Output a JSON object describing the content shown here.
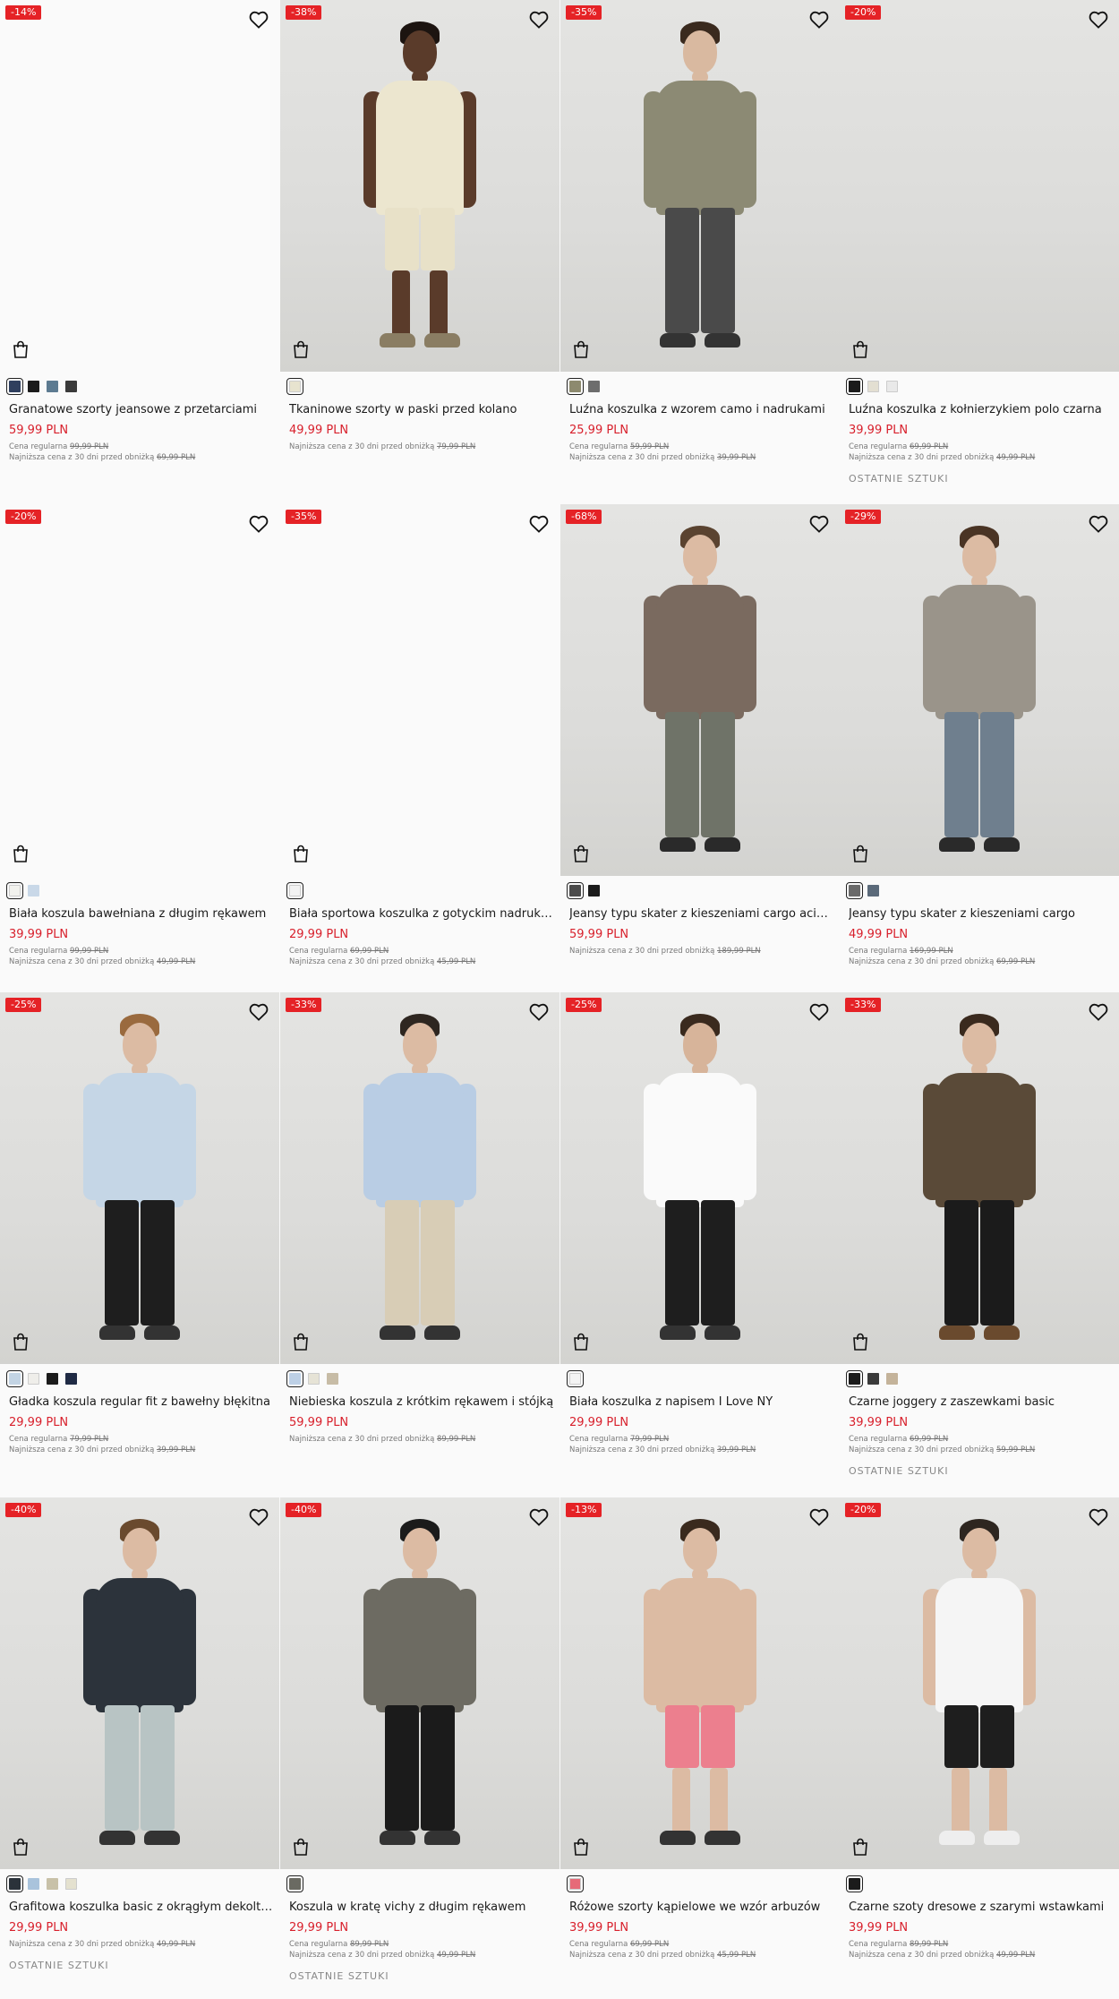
{
  "labels": {
    "regular_prefix": "Cena regularna",
    "lowest_prefix": "Najniższa cena z 30 dni przed obniżką",
    "last_pieces": "OSTATNIE SZTUKI"
  },
  "products": [
    {
      "badge": "-14%",
      "name": "Granatowe szorty jeansowe z przetarciami",
      "price": "59,99 PLN",
      "regular": "99,99 PLN",
      "lowest": "69,99 PLN",
      "last": false,
      "swatches": [
        "#2f3f5e",
        "#1b1b1b",
        "#5d7b91",
        "#3a3a3a"
      ]
    },
    {
      "badge": "-38%",
      "name": "Tkaninowe szorty w paski przed kolano",
      "price": "49,99 PLN",
      "regular": "",
      "lowest": "79,99 PLN",
      "last": false,
      "swatches": [
        "#e7e3cf"
      ]
    },
    {
      "badge": "-35%",
      "name": "Luźna koszulka z wzorem camo i nadrukami",
      "price": "25,99 PLN",
      "regular": "59,99 PLN",
      "lowest": "39,99 PLN",
      "last": false,
      "swatches": [
        "#8d8a6e",
        "#6d6d6d"
      ]
    },
    {
      "badge": "-20%",
      "name": "Luźna koszulka z kołnierzykiem polo czarna",
      "price": "39,99 PLN",
      "regular": "69,99 PLN",
      "lowest": "49,99 PLN",
      "last": true,
      "swatches": [
        "#1b1b1b",
        "#e3dfd2",
        "#e9e9e9"
      ]
    },
    {
      "badge": "-20%",
      "name": "Biała koszula bawełniana z długim rękawem",
      "price": "39,99 PLN",
      "regular": "99,99 PLN",
      "lowest": "49,99 PLN",
      "last": false,
      "swatches": [
        "#f2f2ee",
        "#c9d8e8"
      ]
    },
    {
      "badge": "-35%",
      "name": "Biała sportowa koszulka z gotyckim nadrukiem",
      "price": "29,99 PLN",
      "regular": "69,99 PLN",
      "lowest": "45,99 PLN",
      "last": false,
      "swatches": [
        "#f2f2f2"
      ]
    },
    {
      "badge": "-68%",
      "name": "Jeansy typu skater z kieszeniami cargo acid wash",
      "price": "59,99 PLN",
      "regular": "",
      "lowest": "189,99 PLN",
      "last": false,
      "swatches": [
        "#4b4b4b",
        "#1b1b1b"
      ]
    },
    {
      "badge": "-29%",
      "name": "Jeansy typu skater z kieszeniami cargo",
      "price": "49,99 PLN",
      "regular": "169,99 PLN",
      "lowest": "69,99 PLN",
      "last": false,
      "swatches": [
        "#6a6a6a",
        "#5b6a7a"
      ]
    },
    {
      "badge": "-25%",
      "name": "Gładka koszula regular fit z bawełny błękitna",
      "price": "29,99 PLN",
      "regular": "79,99 PLN",
      "lowest": "39,99 PLN",
      "last": false,
      "swatches": [
        "#c3d4e4",
        "#efeeea",
        "#1b1b1b",
        "#1f2a44"
      ]
    },
    {
      "badge": "-33%",
      "name": "Niebieska koszula z krótkim rękawem i stójką",
      "price": "59,99 PLN",
      "regular": "",
      "lowest": "89,99 PLN",
      "last": false,
      "swatches": [
        "#bdd0e6",
        "#e6e3d6",
        "#c7bca6"
      ]
    },
    {
      "badge": "-25%",
      "name": "Biała koszulka z napisem I Love NY",
      "price": "29,99 PLN",
      "regular": "79,99 PLN",
      "lowest": "39,99 PLN",
      "last": false,
      "swatches": [
        "#f4f4f4"
      ]
    },
    {
      "badge": "-33%",
      "name": "Czarne joggery z zaszewkami basic",
      "price": "39,99 PLN",
      "regular": "69,99 PLN",
      "lowest": "59,99 PLN",
      "last": true,
      "swatches": [
        "#1b1b1b",
        "#3a3a3a",
        "#c4b39a"
      ]
    },
    {
      "badge": "-40%",
      "name": "Grafitowa koszulka basic z okrągłym dekoltem",
      "price": "29,99 PLN",
      "regular": "",
      "lowest": "49,99 PLN",
      "last": true,
      "swatches": [
        "#2b323a",
        "#a9c3dc",
        "#c8c1a8",
        "#e4e1cf"
      ]
    },
    {
      "badge": "-40%",
      "name": "Koszula w kratę vichy z długim rękawem",
      "price": "29,99 PLN",
      "regular": "89,99 PLN",
      "lowest": "49,99 PLN",
      "last": true,
      "swatches": [
        "#6a6a62"
      ]
    },
    {
      "badge": "-13%",
      "name": "Różowe szorty kąpielowe we wzór arbuzów",
      "price": "39,99 PLN",
      "regular": "69,99 PLN",
      "lowest": "45,99 PLN",
      "last": false,
      "swatches": [
        "#e66a78"
      ]
    },
    {
      "badge": "-20%",
      "name": "Czarne szoty dresowe z szarymi wstawkami",
      "price": "39,99 PLN",
      "regular": "89,99 PLN",
      "lowest": "49,99 PLN",
      "last": false,
      "swatches": [
        "#1b1b1b"
      ]
    }
  ]
}
